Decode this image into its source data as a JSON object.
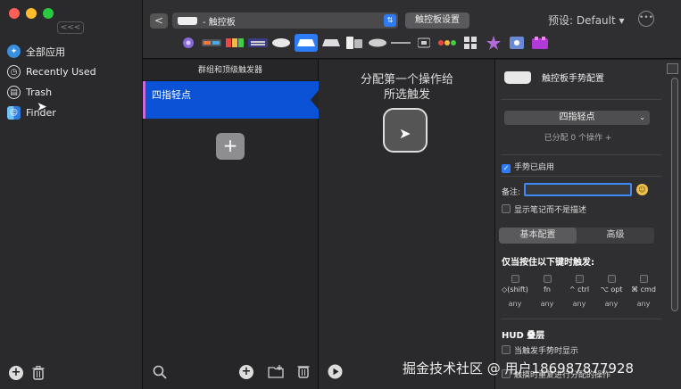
{
  "sidebar": {
    "collapse_label": "<<<",
    "items": [
      {
        "label": "全部应用",
        "icon": "all-apps-icon"
      },
      {
        "label": "Recently Used",
        "icon": "recent-icon"
      },
      {
        "label": "Trash",
        "icon": "trash-icon"
      },
      {
        "label": "Finder",
        "icon": "finder-icon"
      }
    ]
  },
  "toolbar": {
    "back_label": "<",
    "device_select": "- 触控板",
    "settings_label": "触控板设置",
    "preset_label": "预设: Default ▾"
  },
  "triggers": {
    "header": "群组和顶级触发器",
    "selected": "四指轻点"
  },
  "actions": {
    "assign_line1": "分配第一个操作给",
    "assign_line2": "所选触发"
  },
  "config": {
    "title": "触控板手势配置",
    "gesture": "四指轻点",
    "assigned_count": "已分配 0 个操作 +",
    "gesture_enabled": "手势已启用",
    "note_label": "备注:",
    "show_note": "显示笔记而不是描述",
    "tabs": [
      "基本配置",
      "高级"
    ],
    "modifiers_title": "仅当按住以下键时触发:",
    "modifiers": [
      {
        "key": "◇(shift)",
        "mode": "any"
      },
      {
        "key": "fn",
        "mode": "any"
      },
      {
        "key": "^ ctrl",
        "mode": "any"
      },
      {
        "key": "⌥ opt",
        "mode": "any"
      },
      {
        "key": "⌘ cmd",
        "mode": "any"
      }
    ],
    "hud_title": "HUD 叠层",
    "hud_option": "当触发手势时显示",
    "hud_option2": "触摸时重复进行分配的操作"
  },
  "watermark": "掘金技术社区 @ 用户186987877928",
  "colors": {
    "accent": "#0b52d6",
    "selection_bar": "#c86bd8",
    "traffic_red": "#fe5f57",
    "traffic_yellow": "#febc2e",
    "traffic_green": "#28c840"
  }
}
